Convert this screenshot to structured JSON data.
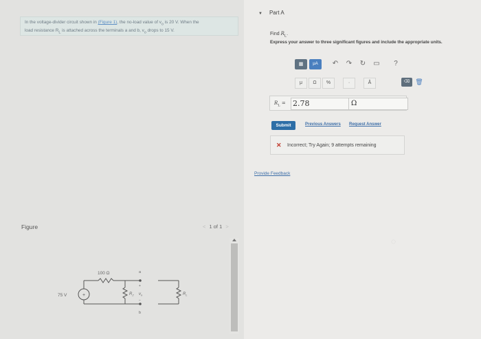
{
  "problem": {
    "text_before_link": "In the voltage-divider circuit shown in ",
    "link_text": "(Figure 1)",
    "text_line1_after": ", the no-load value of v",
    "sub_o": "o",
    "text_line1_end": " is 20 V. When the",
    "text_line2_start": "load resistance R",
    "sub_L": "L",
    "text_line2_mid": " is attached across the terminals a and b, v",
    "text_line2_end": " drops to 15 V."
  },
  "figure": {
    "label": "Figure",
    "page_indicator": "1 of 1",
    "prev_arrow": "<",
    "next_arrow": ">",
    "circuit": {
      "source": "75 V",
      "r1": "100 Ω",
      "r2": "R",
      "r2_sub": "2",
      "vo": "v",
      "vo_sub": "o",
      "rl": "R",
      "rl_sub": "L",
      "terminal_a": "a",
      "terminal_b": "b",
      "plus": "+",
      "minus": "−"
    }
  },
  "part": {
    "arrow": "▼",
    "title": "Part A",
    "find_prefix": "Find ",
    "find_var": "R",
    "find_sub": "L",
    "find_suffix": ".",
    "instructions": "Express your answer to three significant figures and include the appropriate units."
  },
  "toolbar": {
    "templates_icon": "templates-icon",
    "units_label": "μA",
    "undo": "↶",
    "redo": "↷",
    "reset": "↻",
    "keyboard": "▭",
    "help": "?",
    "unit_mu": "μ",
    "unit_omega": "Ω",
    "unit_percent": "%",
    "unit_dot": "·",
    "unit_angstrom": "Å"
  },
  "answer": {
    "label_var": "R",
    "label_sub": "L",
    "label_eq": " = ",
    "value": "2.78",
    "unit": "Ω"
  },
  "actions": {
    "submit": "Submit",
    "previous_answers": "Previous Answers",
    "request_answer": "Request Answer"
  },
  "feedback": {
    "icon": "✕",
    "message": "Incorrect; Try Again; 9 attempts remaining"
  },
  "provide_feedback": "Provide Feedback",
  "colors": {
    "submit": "#2d6ea7",
    "link": "#3d6ea8",
    "error": "#c0392b"
  }
}
